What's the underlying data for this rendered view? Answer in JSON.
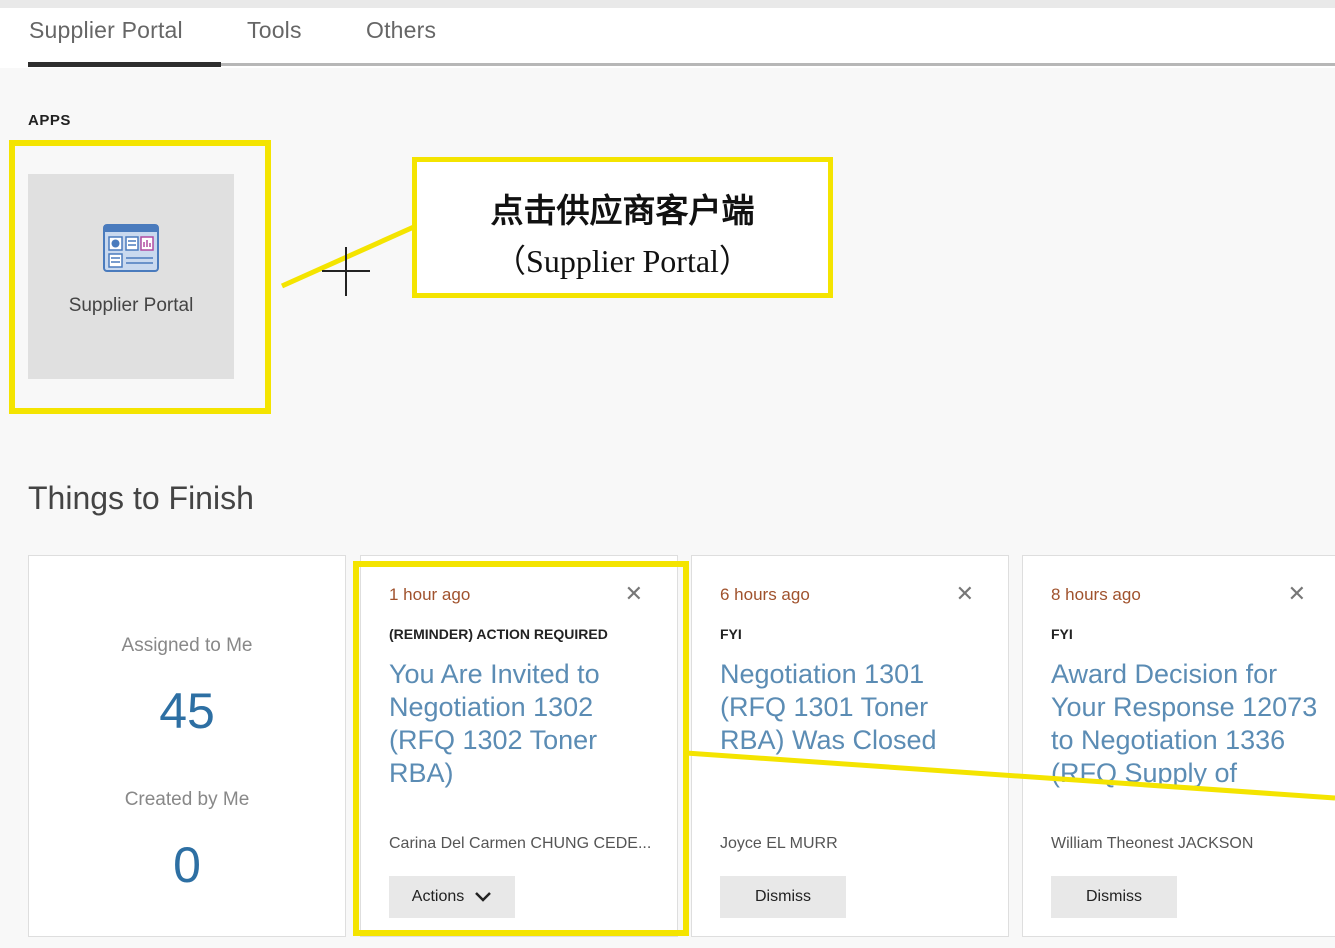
{
  "tabs": [
    {
      "label": "Supplier Portal",
      "active": true
    },
    {
      "label": "Tools",
      "active": false
    },
    {
      "label": "Others",
      "active": false
    }
  ],
  "apps": {
    "heading": "APPS",
    "tiles": [
      {
        "label": "Supplier Portal",
        "icon": "dashboard-icon"
      }
    ]
  },
  "annotation": {
    "line1": "点击供应商客户端",
    "line2": "（Supplier Portal）",
    "highlight_color": "#f4e400"
  },
  "things_to_finish": {
    "heading": "Things to Finish",
    "summary": {
      "assigned_label": "Assigned to Me",
      "assigned_count": "45",
      "created_label": "Created by Me",
      "created_count": "0"
    },
    "notifications": [
      {
        "time": "1 hour ago",
        "category": "(REMINDER) ACTION REQUIRED",
        "title": "You Are Invited to Negotiation 1302 (RFQ 1302 Toner RBA)",
        "person": "Carina Del Carmen CHUNG CEDE...",
        "button": "Actions",
        "button_icon": "chevron-down-icon"
      },
      {
        "time": "6 hours ago",
        "category": "FYI",
        "title": "Negotiation 1301 (RFQ 1301 Toner RBA) Was Closed",
        "person": "Joyce EL MURR",
        "button": "Dismiss"
      },
      {
        "time": "8 hours ago",
        "category": "FYI",
        "title": "Award Decision for Your Response 12073 to Negotiation 1336 (RFQ Supply of soap...",
        "person": "William Theonest JACKSON",
        "button": "Dismiss"
      }
    ]
  },
  "colors": {
    "accent_link": "#5b8cb4",
    "count": "#2d6fa3",
    "time": "#a0522d"
  }
}
